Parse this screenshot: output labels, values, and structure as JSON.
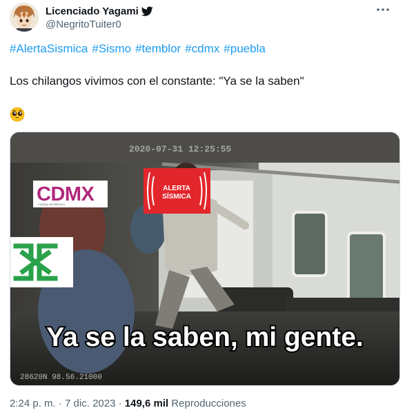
{
  "author": {
    "display_name": "Licenciado Yagami",
    "handle": "@NegritoTuiter0",
    "badge_icon": "twitter-bird-icon",
    "avatar_icon": "anime-avatar-icon"
  },
  "tweet": {
    "hashtags": [
      "#AlertaSismica",
      "#Sismo",
      "#temblor",
      "#cdmx",
      "#puebla"
    ],
    "text": "Los chilangos vivimos con el constante: \"Ya se la saben\"",
    "emoji_icon": "pleading-face-emoji-icon"
  },
  "media": {
    "timestamp_overlay": "2020-07-31 12:25:55",
    "cdmx_logo_text": "CDMX",
    "cdmx_logo_subtext": "CIUDAD DE MÉXICO",
    "alert_line1": "ALERTA",
    "alert_line2": "SÍSMICA",
    "caption": "Ya se la saben, mi gente.",
    "gps_overlay": "28620N 98.56.21000"
  },
  "meta": {
    "time": "2:24 p. m.",
    "separator": " · ",
    "date": "7 dic. 2023",
    "views_count": "149,6 mil",
    "views_label": "Reproducciones"
  },
  "colors": {
    "accent": "#1d9bf0",
    "text_primary": "#0f1419",
    "text_secondary": "#536471",
    "alert_red": "#e3262b",
    "cdmx_green": "#2aa14a",
    "cdmx_pink": "#b0287b"
  }
}
